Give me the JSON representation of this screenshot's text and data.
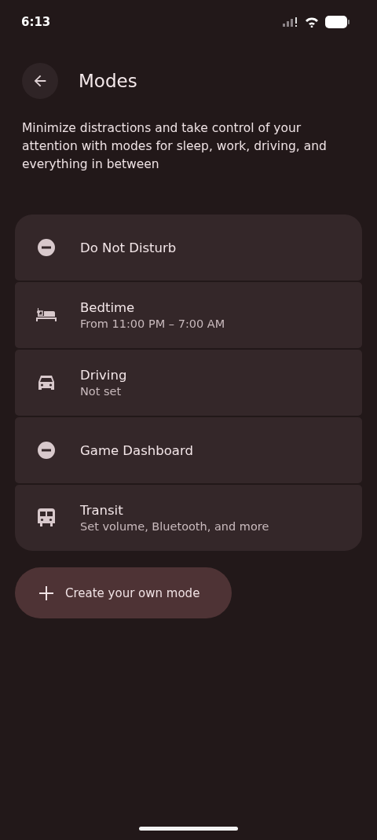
{
  "status_bar": {
    "time": "6:13"
  },
  "header": {
    "title": "Modes"
  },
  "description": "Minimize distractions and take control of your attention with modes for sleep, work, driving, and everything in between",
  "modes": [
    {
      "kind": "dnd",
      "name": "Do Not Disturb"
    },
    {
      "kind": "bedtime",
      "name": "Bedtime",
      "summary": "From 11:00 PM – 7:00 AM"
    },
    {
      "kind": "driving",
      "name": "Driving",
      "summary": "Not set"
    },
    {
      "kind": "dnd",
      "name": "Game Dashboard"
    },
    {
      "kind": "transit",
      "name": "Transit",
      "summary": "Set volume, Bluetooth, and more"
    }
  ],
  "create_button": {
    "label": "Create your own mode"
  }
}
